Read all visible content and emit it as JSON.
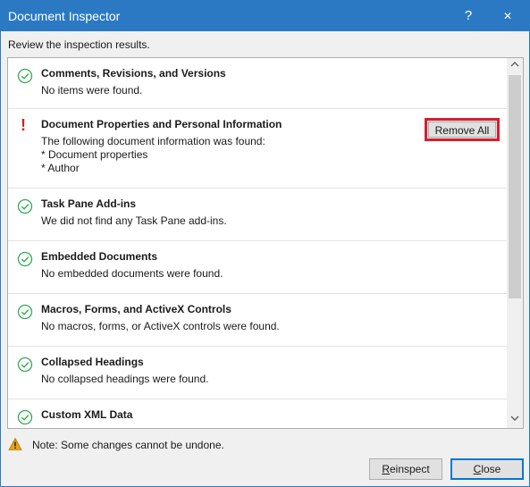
{
  "window": {
    "title": "Document Inspector",
    "help_glyph": "?",
    "close_glyph": "✕"
  },
  "subtitle": "Review the inspection results.",
  "results": [
    {
      "status": "ok",
      "heading": "Comments, Revisions, and Versions",
      "lines": [
        "No items were found."
      ]
    },
    {
      "status": "issue",
      "heading": "Document Properties and Personal Information",
      "lines": [
        "The following document information was found:",
        "* Document properties",
        "* Author"
      ]
    },
    {
      "status": "ok",
      "heading": "Task Pane Add-ins",
      "lines": [
        "We did not find any Task Pane add-ins."
      ]
    },
    {
      "status": "ok",
      "heading": "Embedded Documents",
      "lines": [
        "No embedded documents were found."
      ]
    },
    {
      "status": "ok",
      "heading": "Macros, Forms, and ActiveX Controls",
      "lines": [
        "No macros, forms, or ActiveX controls were found."
      ]
    },
    {
      "status": "ok",
      "heading": "Collapsed Headings",
      "lines": [
        "No collapsed headings were found."
      ]
    },
    {
      "status": "ok",
      "heading": "Custom XML Data",
      "lines": []
    }
  ],
  "issue_glyph": "!",
  "remove_all_label": "Remove All",
  "note": "Note: Some changes cannot be undone.",
  "buttons": {
    "reinspect_underlined": "R",
    "reinspect_rest": "einspect",
    "close_underlined": "C",
    "close_rest": "lose"
  },
  "colors": {
    "titlebar": "#2b79c2",
    "ok_icon": "#33a852",
    "issue_icon": "#c42b1c",
    "highlight_border": "#d42030",
    "warning_icon": "#e8a317"
  }
}
